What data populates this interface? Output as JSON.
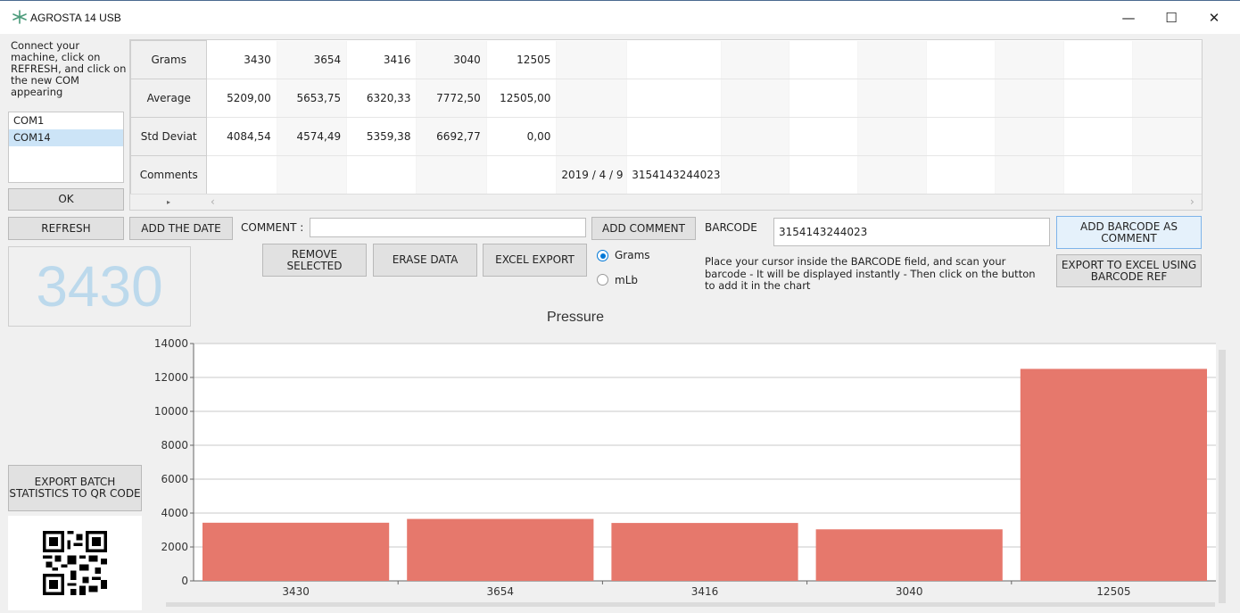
{
  "window": {
    "title": "AGROSTA 14 USB",
    "minimize": "—",
    "maximize": "☐",
    "close": "✕"
  },
  "sidebar": {
    "help_text": "Connect your machine, click on REFRESH, and click on the new COM appearing",
    "com_ports": [
      "COM1",
      "COM14"
    ],
    "selected_port": "COM14",
    "ok_label": "OK",
    "refresh_label": "REFRESH",
    "big_value": "3430",
    "export_qr_label": "EXPORT BATCH STATISTICS TO QR CODE"
  },
  "grid": {
    "rows": [
      {
        "header": "Grams",
        "cells": [
          "3430",
          "3654",
          "3416",
          "3040",
          "12505",
          "",
          "",
          "",
          "",
          "",
          "",
          "",
          "",
          ""
        ]
      },
      {
        "header": "Average",
        "cells": [
          "5209,00",
          "5653,75",
          "6320,33",
          "7772,50",
          "12505,00",
          "",
          "",
          "",
          "",
          "",
          "",
          "",
          "",
          ""
        ]
      },
      {
        "header": "Std Deviat",
        "cells": [
          "4084,54",
          "4574,49",
          "5359,38",
          "6692,77",
          "0,00",
          "",
          "",
          "",
          "",
          "",
          "",
          "",
          "",
          ""
        ]
      },
      {
        "header": "Comments",
        "cells": [
          "",
          "",
          "",
          "",
          "",
          "2019 / 4 / 9",
          "3154143244023",
          "",
          "",
          "",
          "",
          "",
          "",
          ""
        ]
      }
    ],
    "scroll_left_glyph": "‹",
    "scroll_right_glyph": "›",
    "row_marker_glyph": "▸"
  },
  "controls": {
    "add_date_label": "ADD THE DATE",
    "comment_label": "COMMENT :",
    "comment_value": "",
    "add_comment_label": "ADD COMMENT",
    "barcode_label": "BARCODE",
    "barcode_value": "3154143244023",
    "add_barcode_label": "ADD BARCODE AS COMMENT",
    "export_barcode_label": "EXPORT TO EXCEL USING BARCODE REF",
    "remove_selected_label": "REMOVE SELECTED",
    "erase_data_label": "ERASE DATA",
    "excel_export_label": "EXCEL EXPORT",
    "units": [
      {
        "label": "Grams",
        "selected": true
      },
      {
        "label": "mLb",
        "selected": false
      }
    ],
    "instructions": "Place your cursor inside the BARCODE field, and scan your barcode - It will be displayed instantly - Then click on the button to add it in the chart"
  },
  "colors": {
    "bar": "#e6786c",
    "accent": "#0078d7",
    "big_value": "#bcd9ec"
  },
  "chart_data": {
    "type": "bar",
    "title": "Pressure",
    "categories": [
      "3430",
      "3654",
      "3416",
      "3040",
      "12505"
    ],
    "values": [
      3430,
      3654,
      3416,
      3040,
      12505
    ],
    "ylim": [
      0,
      14000
    ],
    "yticks": [
      0,
      2000,
      4000,
      6000,
      8000,
      10000,
      12000,
      14000
    ],
    "grid": true,
    "legend": "none"
  }
}
